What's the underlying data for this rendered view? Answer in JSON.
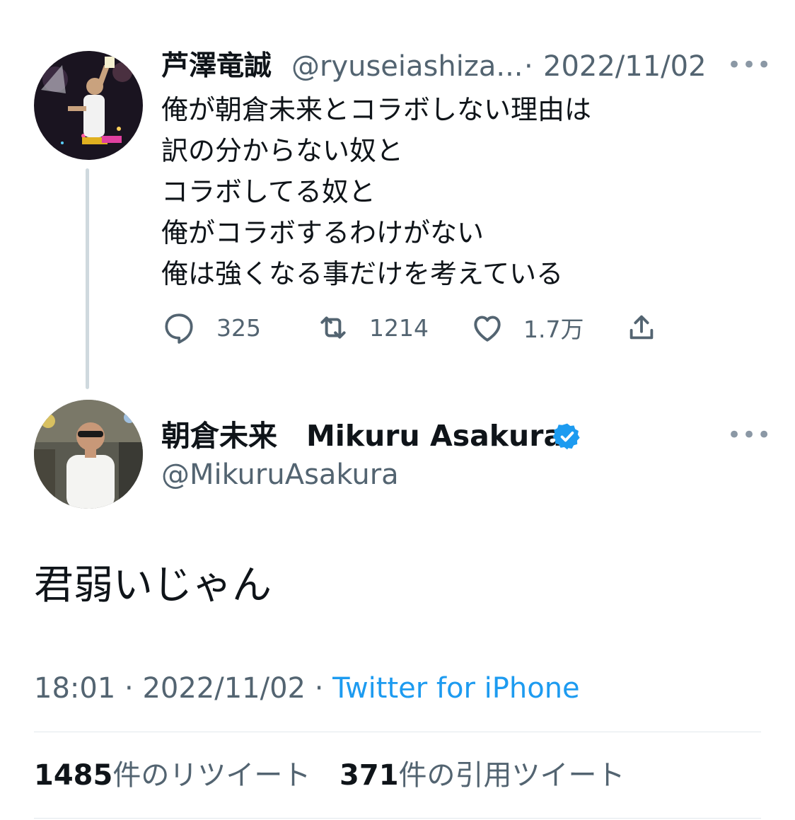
{
  "parent_tweet": {
    "display_name": "芦澤竜誠",
    "handle": "@ryuseiashiza...",
    "separator": "·",
    "date": "2022/11/02",
    "more": "•••",
    "text": "俺が朝倉未来とコラボしない理由は\n訳の分からない奴と\nコラボしてる奴と\n俺がコラボするわけがない\n俺は強くなる事だけを考えている",
    "actions": {
      "reply_count": "325",
      "retweet_count": "1214",
      "like_count": "1.7万"
    }
  },
  "main_tweet": {
    "display_name": "朝倉未来　Mikuru Asakura",
    "handle": "@MikuruAsakura",
    "more": "•••",
    "text": "君弱いじゃん",
    "time": "18:01",
    "date": "2022/11/02",
    "separator": "·",
    "source": "Twitter for iPhone",
    "verified_icon": "verified-badge-icon"
  },
  "stats": {
    "retweets_count": "1485",
    "retweets_label": "件のリツイート",
    "quotes_count": "371",
    "quotes_label": "件の引用ツイート"
  },
  "colors": {
    "text": "#0f1419",
    "secondary": "#536471",
    "accent": "#1d9bf0",
    "divider": "#e1e8ed",
    "thread_line": "#cfd9de"
  }
}
